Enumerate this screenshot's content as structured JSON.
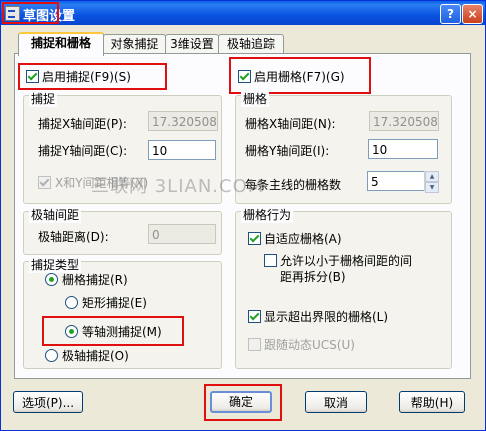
{
  "window": {
    "title": "草图设置",
    "help_glyph": "?",
    "close_glyph": "×"
  },
  "tabs": [
    {
      "label": "捕捉和栅格",
      "active": true
    },
    {
      "label": "对象捕捉",
      "active": false
    },
    {
      "label": "3维设置",
      "active": false
    },
    {
      "label": "极轴追踪",
      "active": false
    }
  ],
  "snap": {
    "enable_label": "启用捕捉(F9)(S)",
    "enable_checked": true,
    "group_title": "捕捉",
    "x_label": "捕捉X轴间距(P):",
    "x_value": "17.32050807",
    "y_label": "捕捉Y轴间距(C):",
    "y_value": "10",
    "equal_label": "X和Y间距相等(X)",
    "equal_checked": true
  },
  "grid": {
    "enable_label": "启用栅格(F7)(G)",
    "enable_checked": true,
    "group_title": "栅格",
    "x_label": "栅格X轴间距(N):",
    "x_value": "17.32050807",
    "y_label": "栅格Y轴间距(I):",
    "y_value": "10",
    "major_label": "每条主线的栅格数",
    "major_value": "5"
  },
  "polar": {
    "group_title": "极轴间距",
    "distance_label": "极轴距离(D):",
    "distance_value": "0"
  },
  "snap_type": {
    "group_title": "捕捉类型",
    "grid_snap_label": "栅格捕捉(R)",
    "rect_label": "矩形捕捉(E)",
    "iso_label": "等轴测捕捉(M)",
    "polar_label": "极轴捕捉(O)",
    "selected": "iso"
  },
  "grid_behavior": {
    "group_title": "栅格行为",
    "adaptive_label": "自适应栅格(A)",
    "adaptive_checked": true,
    "subdivide_line1": "允许以小于栅格间距的间",
    "subdivide_line2": "距再拆分(B)",
    "subdivide_checked": false,
    "beyond_label": "显示超出界限的栅格(L)",
    "beyond_checked": true,
    "ucs_label": "跟随动态UCS(U)",
    "ucs_checked": false
  },
  "buttons": {
    "options": "选项(P)...",
    "ok": "确定",
    "cancel": "取消",
    "help": "帮助(H)"
  },
  "watermark": "三联网 3LIAN.COM"
}
